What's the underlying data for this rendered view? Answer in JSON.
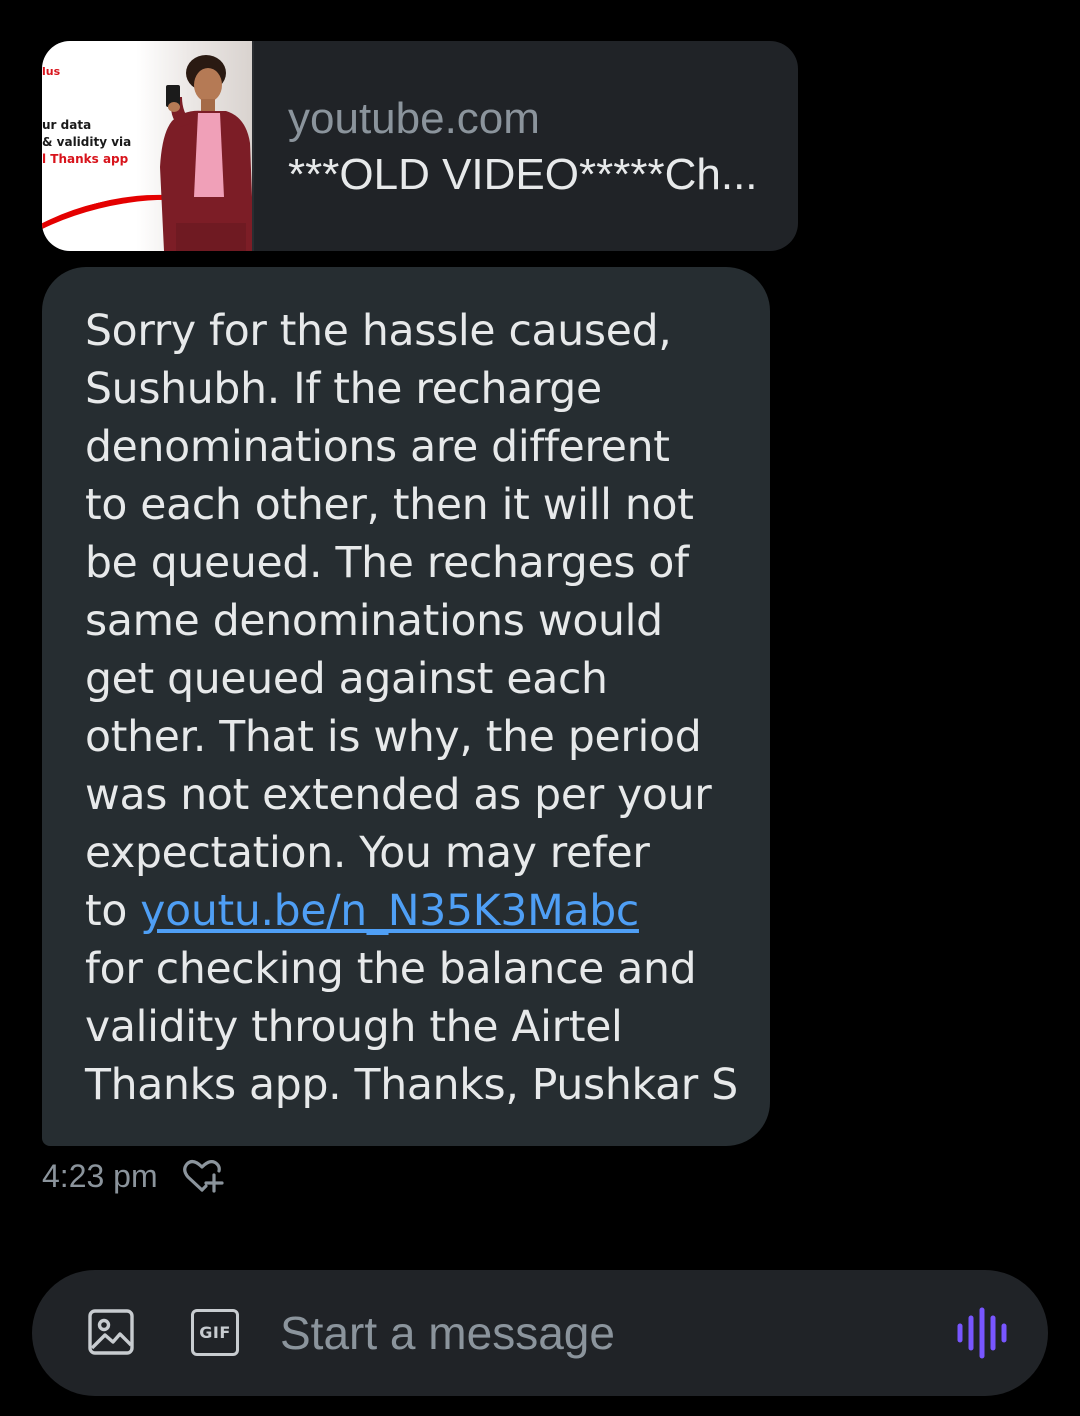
{
  "link_preview": {
    "thumbnail": {
      "brand_fragment": "lus",
      "promo_lines": [
        "ur data",
        "& validity via",
        "l Thanks app"
      ]
    },
    "domain": "youtube.com",
    "title": "***OLD VIDEO*****Ch..."
  },
  "message": {
    "lines": [
      "Sorry for the hassle caused,",
      "Sushubh. If the recharge",
      "denominations are different",
      "to each other, then it will not",
      "be queued. The recharges of",
      "same denominations would",
      "get queued against each",
      "other. That is why, the period",
      "was not extended as per your",
      "expectation. You may refer"
    ],
    "link_prefix": "to ",
    "link_text": "youtu.be/n_N35K3Mabc",
    "lines_after": [
      "for checking the balance and",
      "validity through the Airtel",
      "Thanks app. Thanks, Pushkar S"
    ],
    "timestamp": "4:23 pm"
  },
  "composer": {
    "placeholder": "Start a message",
    "gif_label": "GIF"
  },
  "colors": {
    "background": "#000000",
    "bubble": "#262d31",
    "card": "#202327",
    "link": "#4f9ff5",
    "voice_accent": "#7856ff",
    "muted_text": "#8b949c"
  },
  "icons": {
    "react": "heart-plus-icon",
    "media": "image-icon",
    "gif": "gif-icon",
    "voice": "voice-waveform-icon"
  }
}
